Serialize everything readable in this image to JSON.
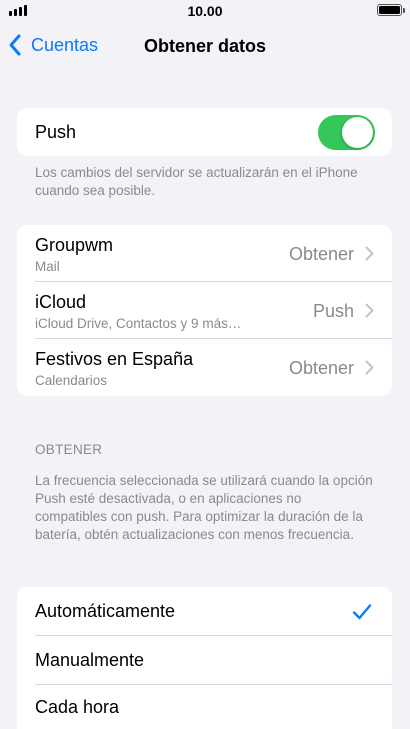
{
  "status": {
    "time": "10.00"
  },
  "nav": {
    "back_label": "Cuentas",
    "title": "Obtener datos"
  },
  "push": {
    "label": "Push",
    "enabled": true,
    "footer": "Los cambios del servidor se actualizarán en el iPhone cuando sea posible."
  },
  "accounts": [
    {
      "name": "Groupwm",
      "subtitle": "Mail",
      "value": "Obtener"
    },
    {
      "name": "iCloud",
      "subtitle": "iCloud Drive, Contactos y 9 más…",
      "value": "Push"
    },
    {
      "name": "Festivos en España",
      "subtitle": "Calendarios",
      "value": "Obtener"
    }
  ],
  "fetch": {
    "header": "OBTENER",
    "footer": "La frecuencia seleccionada se utilizará cuando la opción Push esté desactivada, o en aplicaciones no compatibles con push. Para optimizar la duración de la batería, obtén actualizaciones con menos frecuencia.",
    "options": [
      {
        "label": "Automáticamente",
        "selected": true
      },
      {
        "label": "Manualmente",
        "selected": false
      },
      {
        "label": "Cada hora",
        "selected": false
      }
    ]
  },
  "colors": {
    "accent": "#0a7aff",
    "toggle_on": "#34c759"
  }
}
